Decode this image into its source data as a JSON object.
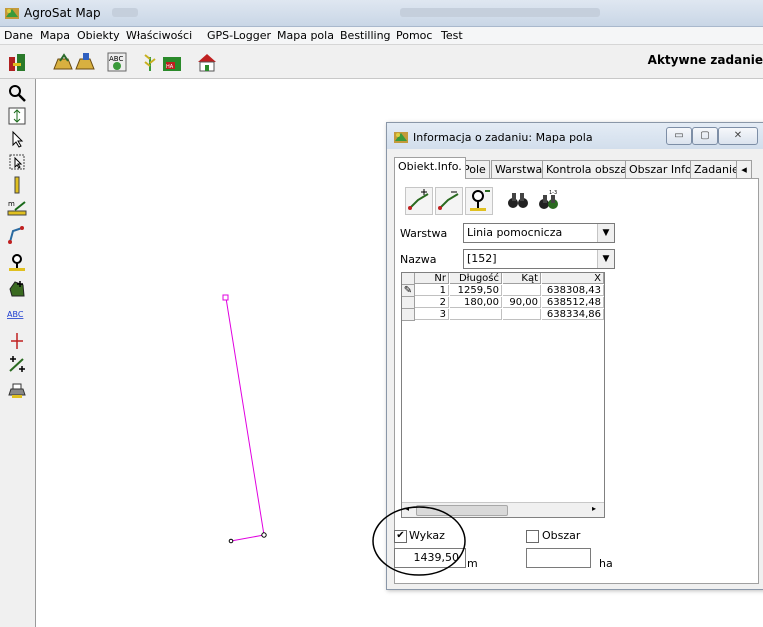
{
  "app": {
    "title": "AgroSat Map"
  },
  "menu": [
    "Dane",
    "Mapa",
    "Obiekty",
    "Właściwości",
    "GPS-Logger",
    "Mapa pola",
    "Bestilling",
    "Pomoc",
    "Test"
  ],
  "toolbar": {
    "active_task_label": "Aktywne zadanie"
  },
  "dialog": {
    "title": "Informacja o zadaniu: Mapa pola",
    "tabs": [
      "Obiekt.Info.",
      "Pole",
      "Warstwa",
      "Kontrola obszaru",
      "Obszar Info.",
      "Zadanie"
    ],
    "warstwa_label": "Warstwa",
    "warstwa_value": "Linia pomocnicza",
    "nazwa_label": "Nazwa",
    "nazwa_value": "[152]",
    "grid": {
      "headers": [
        "Nr",
        "Długość",
        "Kąt",
        "X"
      ],
      "rows": [
        [
          "1",
          "1259,50",
          "",
          "638308,43"
        ],
        [
          "2",
          "180,00",
          "90,00",
          "638512,48"
        ],
        [
          "3",
          "",
          "",
          "638334,86"
        ]
      ]
    },
    "wykaz_label": "Wykaz",
    "wykaz_checked": true,
    "obszar_label": "Obszar",
    "obszar_checked": false,
    "length_value": "1439,50",
    "length_unit": "m",
    "area_value": "",
    "area_unit": "ha"
  },
  "colors": {
    "polyline": "#e000e0",
    "annotation_circle": "#000000"
  },
  "icons": {
    "window_controls": [
      "minimize-icon",
      "maximize-icon",
      "close-icon"
    ],
    "toolbar": [
      "agrosat-logo-icon",
      "open-field-icon",
      "save-field-icon",
      "abc-label-icon",
      "crop-icon",
      "harvest-ha-icon",
      "farm-icon"
    ],
    "left_tools": [
      "zoom-icon",
      "refresh-icon",
      "pointer-icon",
      "select-area-icon",
      "measure-vertical-icon",
      "measure-line-icon",
      "draw-line-icon",
      "gps-marker-icon",
      "add-polygon-icon",
      "abc-text-icon",
      "split-icon",
      "divide-add-icon",
      "print-icon"
    ]
  }
}
